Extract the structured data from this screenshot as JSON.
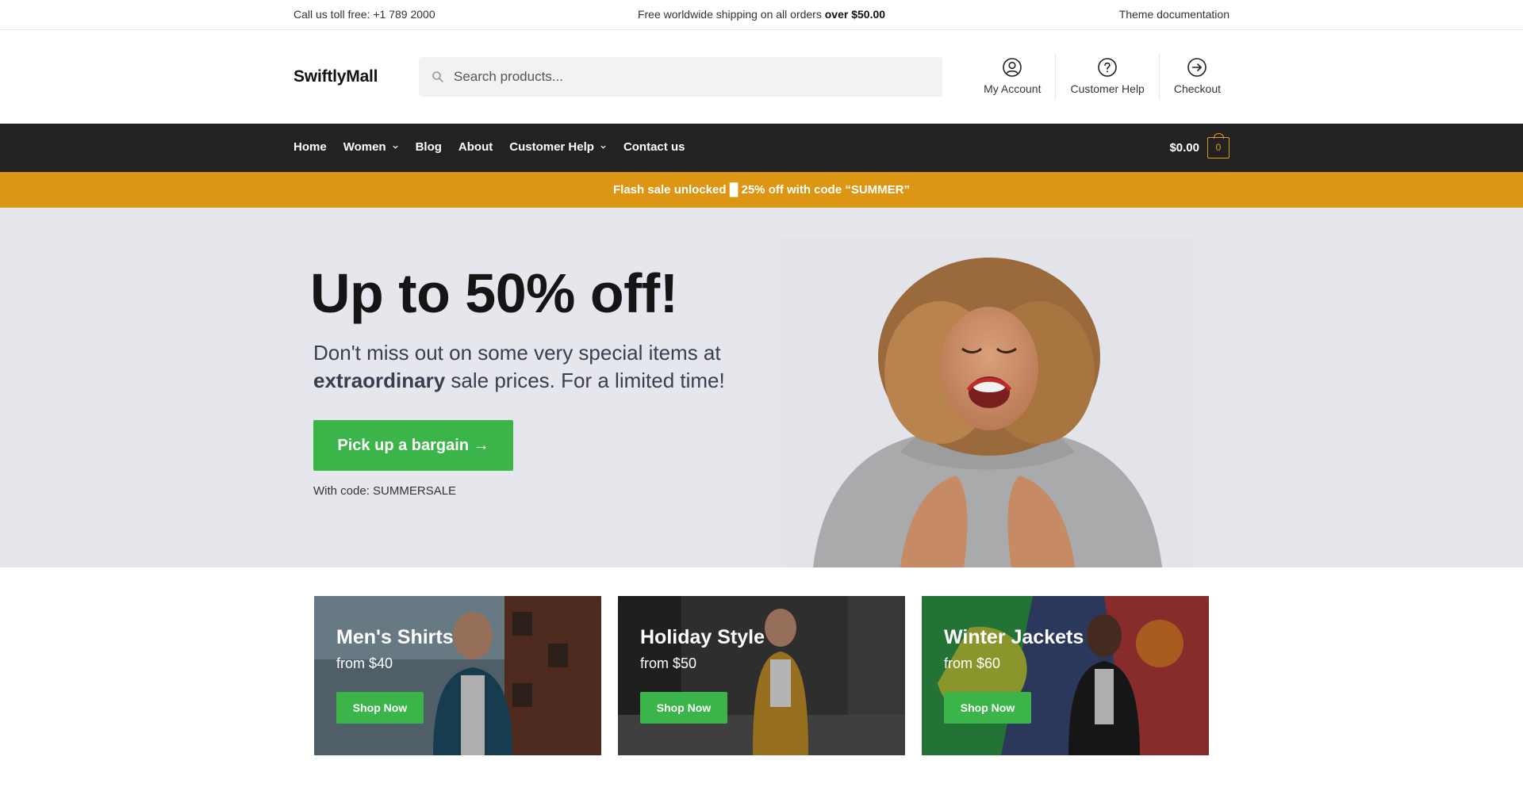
{
  "topbar": {
    "phone_text": "Call us toll free: +1 789 2000",
    "shipping_text": "Free worldwide shipping on all orders ",
    "shipping_bold": "over $50.00",
    "docs_link": "Theme documentation"
  },
  "header": {
    "logo": "SwiftlyMall",
    "search_placeholder": "Search products...",
    "links": [
      {
        "label": "My Account",
        "icon": "user-icon"
      },
      {
        "label": "Customer Help",
        "icon": "help-icon"
      },
      {
        "label": "Checkout",
        "icon": "checkout-icon"
      }
    ]
  },
  "nav": {
    "items": [
      {
        "label": "Home"
      },
      {
        "label": "Women"
      },
      {
        "label": "Blog"
      },
      {
        "label": "About"
      },
      {
        "label": "Customer Help"
      },
      {
        "label": "Contact us"
      }
    ],
    "cart_amount": "$0.00",
    "cart_count": "0"
  },
  "flash": {
    "text": "Flash sale unlocked █ 25% off with code “SUMMER”"
  },
  "hero": {
    "headline": "Up to 50% off!",
    "sub_pre": "Don't miss out on some very special items at ",
    "sub_bold": "extraordinary",
    "sub_post": " sale prices. For a limited time!",
    "cta": "Pick up a bargain →",
    "code_text": "With code: SUMMERSALE"
  },
  "categories": [
    {
      "title": "Men's Shirts",
      "price": "from $40",
      "button": "Shop Now"
    },
    {
      "title": "Holiday Style",
      "price": "from $50",
      "button": "Shop Now"
    },
    {
      "title": "Winter Jackets",
      "price": "from $60",
      "button": "Shop Now"
    }
  ],
  "colors": {
    "nav_bg": "#222222",
    "flash_bg": "#dd9613",
    "accent_green": "#3bb54a",
    "hero_bg": "#e5e7ed"
  }
}
